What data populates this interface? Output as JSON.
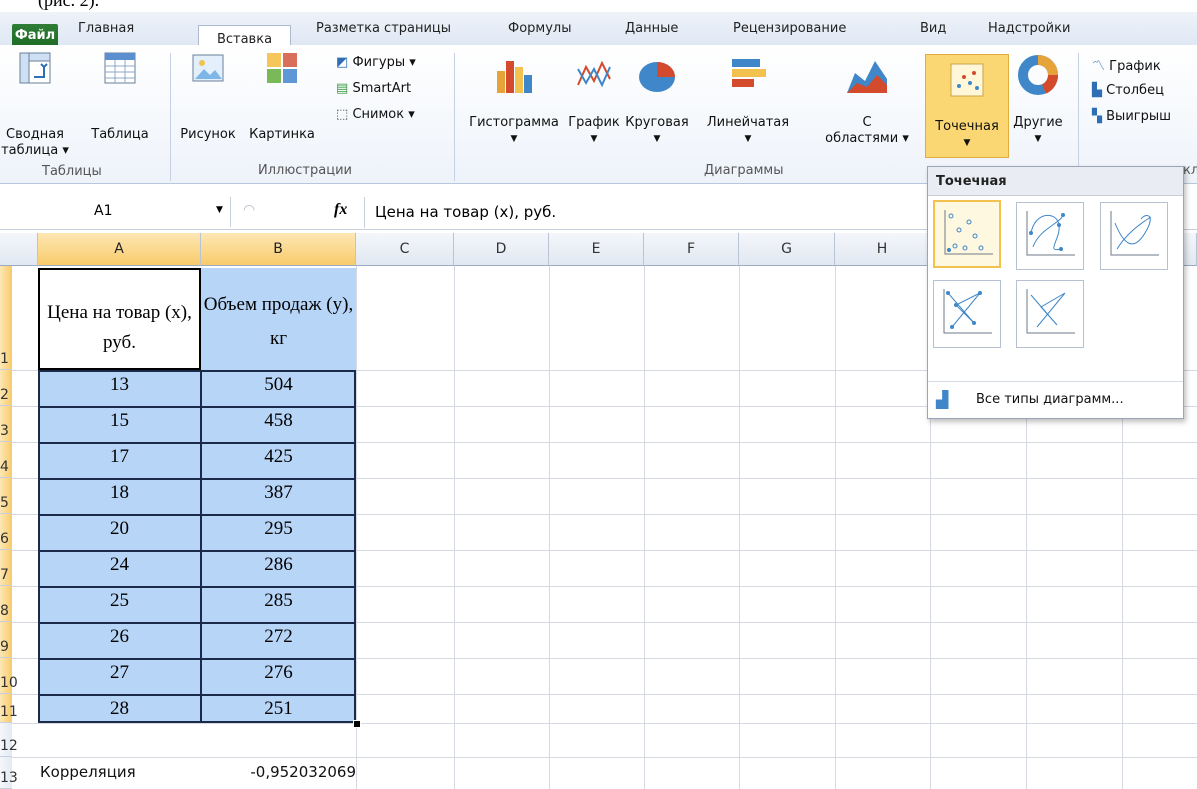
{
  "caption_cutoff": "(рис. 2).",
  "tabs": {
    "file": "Файл",
    "items": [
      "Главная",
      "Вставка",
      "Разметка страницы",
      "Формулы",
      "Данные",
      "Рецензирование",
      "Вид",
      "Надстройки"
    ],
    "active": "Вставка"
  },
  "ribbon": {
    "pivot": {
      "line1": "Сводная",
      "line2": "таблица ▾"
    },
    "table": "Таблица",
    "picture": "Рисунок",
    "clipart": "Картинка",
    "shapes": "Фигуры ▾",
    "smartart": "SmartArt",
    "screenshot": "Снимок ▾",
    "charts": {
      "column": "Гистограмма",
      "line": "График",
      "pie": "Круговая",
      "bar": "Линейчатая",
      "area_line1": "С",
      "area_line2": "областями ▾",
      "scatter": "Точечная",
      "other": "Другие"
    },
    "sparklines": {
      "line": "График",
      "column": "Столбец",
      "winloss": "Выигрыш"
    },
    "group_labels": {
      "tables": "Таблицы",
      "illustrations": "Иллюстрации",
      "charts": "Диаграммы",
      "sparklines_cut": "кл"
    }
  },
  "formula_bar": {
    "name_box": "A1",
    "fx": "fx",
    "value": "Цена на товар (х), руб."
  },
  "columns": [
    "A",
    "B",
    "C",
    "D",
    "E",
    "F",
    "G",
    "H"
  ],
  "rows": [
    "1",
    "2",
    "3",
    "4",
    "5",
    "6",
    "7",
    "8",
    "9",
    "10",
    "11",
    "12",
    "13"
  ],
  "table": {
    "header_a": "Цена на товар (х), руб.",
    "header_b": "Объем продаж (у), кг",
    "data": [
      [
        "13",
        "504"
      ],
      [
        "15",
        "458"
      ],
      [
        "17",
        "425"
      ],
      [
        "18",
        "387"
      ],
      [
        "20",
        "295"
      ],
      [
        "24",
        "286"
      ],
      [
        "25",
        "285"
      ],
      [
        "26",
        "272"
      ],
      [
        "27",
        "276"
      ],
      [
        "28",
        "251"
      ]
    ]
  },
  "correlation": {
    "label": "Корреляция",
    "value": "-0,952032069"
  },
  "scatter_menu": {
    "title": "Точечная",
    "footer": "Все типы диаграмм..."
  },
  "colors": {
    "selection": "#b7d5f7",
    "file_tab": "#2a7a31",
    "active_thumb": "#f2c14e"
  }
}
